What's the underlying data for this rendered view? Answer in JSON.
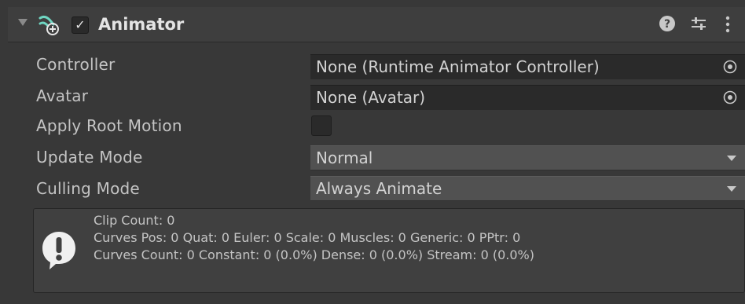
{
  "header": {
    "title": "Animator",
    "enabled_mark": "✓"
  },
  "fields": {
    "controller": {
      "label": "Controller",
      "value": "None (Runtime Animator Controller)"
    },
    "avatar": {
      "label": "Avatar",
      "value": "None (Avatar)"
    },
    "apply_root_motion": {
      "label": "Apply Root Motion",
      "checked": false
    },
    "update_mode": {
      "label": "Update Mode",
      "value": "Normal"
    },
    "culling_mode": {
      "label": "Culling Mode",
      "value": "Always Animate"
    }
  },
  "info": {
    "line1": "Clip Count: 0",
    "line2": "Curves Pos: 0 Quat: 0 Euler: 0 Scale: 0 Muscles: 0 Generic: 0 PPtr: 0",
    "line3": "Curves Count: 0 Constant: 0 (0.0%) Dense: 0 (0.0%) Stream: 0 (0.0%)"
  },
  "icons": {
    "foldout": "triangle-down-icon",
    "component": "animator-component-icon",
    "help": "help-icon",
    "presets": "presets-icon",
    "menu": "kebab-menu-icon",
    "object_picker": "object-picker-icon",
    "dropdown": "dropdown-arrow-icon",
    "info": "exclamation-speech-icon"
  },
  "colors": {
    "background": "#383838",
    "header": "#3e3e3e",
    "field": "#2a2a2a",
    "dropdown": "#515151",
    "helpbox": "#404040",
    "icon_teal": "#6fd6c2"
  }
}
